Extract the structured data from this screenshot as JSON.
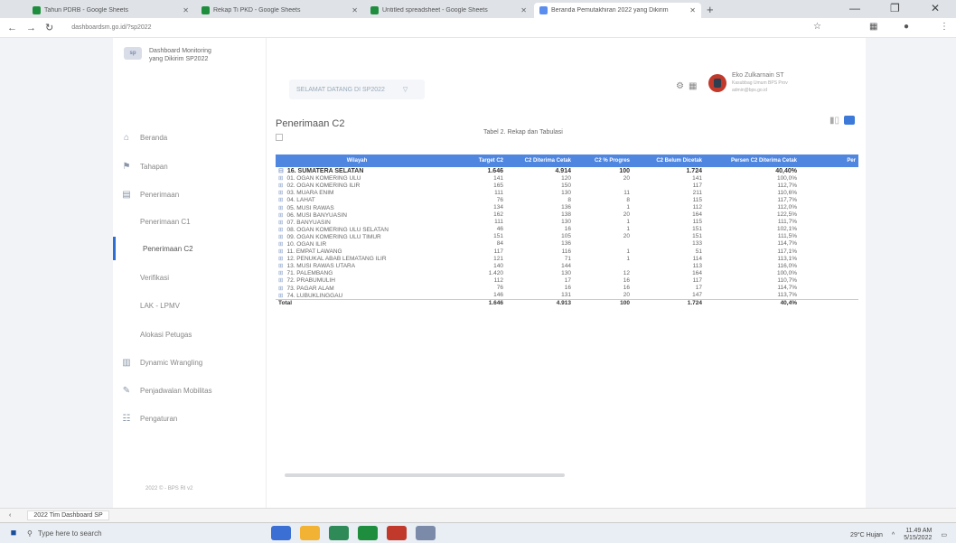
{
  "browser": {
    "tabs": [
      {
        "title": "Tahun PDRB - Google Sheets",
        "color": "#1e8e3e",
        "active": false
      },
      {
        "title": "Rekap Ti PKD - Google Sheets",
        "color": "#1e8e3e",
        "active": false
      },
      {
        "title": "Untitled spreadsheet - Google Sheets",
        "color": "#1e8e3e",
        "active": false
      },
      {
        "title": "Beranda Pemutakhiran 2022 yang Dikirim",
        "color": "#5b8def",
        "active": true
      }
    ],
    "new_tab_label": "+",
    "url": "dashboardsm.go.id/?sp2022"
  },
  "app": {
    "brand_title": "Dashboard Monitoring yang Dikirim SP2022",
    "nav": [
      {
        "label": "Beranda",
        "icon": "home-icon",
        "glyph": "⌂",
        "active": false
      },
      {
        "label": "Tahapan",
        "icon": "flag-icon",
        "glyph": "⚑",
        "active": false
      },
      {
        "label": "Penerimaan",
        "icon": "document-icon",
        "glyph": "▤",
        "active": false
      },
      {
        "label": "Penerimaan C1",
        "icon": "",
        "glyph": "",
        "active": false
      },
      {
        "label": "Penerimaan C2",
        "icon": "",
        "glyph": "",
        "active": true
      },
      {
        "label": "Verifikasi",
        "icon": "",
        "glyph": "",
        "active": false
      },
      {
        "label": "LAK - LPMV",
        "icon": "",
        "glyph": "",
        "active": false
      },
      {
        "label": "Alokasi Petugas",
        "icon": "",
        "glyph": "",
        "active": false
      },
      {
        "label": "Dynamic Wrangling",
        "icon": "chart-icon",
        "glyph": "▥",
        "active": false
      },
      {
        "label": "Penjadwalan Mobilitas",
        "icon": "pen-icon",
        "glyph": "✎",
        "active": false
      },
      {
        "label": "Pengaturan",
        "icon": "settings-icon",
        "glyph": "☷",
        "active": false
      }
    ],
    "footer": "2022 © - BPS RI v2",
    "search_placeholder": "SELAMAT DATANG DI SP2022",
    "user_name": "Eko Zulkarnain ST",
    "user_sub": "Kasubbag Umum BPS Prov",
    "user_role": "admin@bps.go.id"
  },
  "content": {
    "page_title": "Penerimaan C2",
    "table_title": "Tabel 2. Rekap dan Tabulasi",
    "columns": [
      "Wilayah",
      "Target C2",
      "C2 Diterima Cetak",
      "C2 % Progres",
      "C2 Belum Dicetak",
      "Persen C2 Diterima Cetak",
      "Per"
    ],
    "rows": [
      {
        "type": "prov",
        "name": "16. SUMATERA SELATAN",
        "v": [
          "1.646",
          "4.914",
          "100",
          "1.724",
          "40,40%",
          ""
        ]
      },
      {
        "type": "kab",
        "name": "01. OGAN KOMERING ULU",
        "v": [
          "141",
          "120",
          "20",
          "141",
          "100,0%",
          ""
        ]
      },
      {
        "type": "kab",
        "name": "02. OGAN KOMERING ILIR",
        "v": [
          "165",
          "150",
          "",
          "117",
          "112,7%",
          ""
        ]
      },
      {
        "type": "kab",
        "name": "03. MUARA ENIM",
        "v": [
          "111",
          "130",
          "11",
          "211",
          "110,6%",
          ""
        ]
      },
      {
        "type": "kab",
        "name": "04. LAHAT",
        "v": [
          "76",
          "8",
          "8",
          "115",
          "117,7%",
          ""
        ]
      },
      {
        "type": "kab",
        "name": "05. MUSI RAWAS",
        "v": [
          "134",
          "136",
          "1",
          "112",
          "112,0%",
          ""
        ]
      },
      {
        "type": "kab",
        "name": "06. MUSI BANYUASIN",
        "v": [
          "162",
          "138",
          "20",
          "164",
          "122,5%",
          ""
        ]
      },
      {
        "type": "kab",
        "name": "07. BANYUASIN",
        "v": [
          "111",
          "130",
          "1",
          "115",
          "111,7%",
          ""
        ]
      },
      {
        "type": "kab",
        "name": "08. OGAN KOMERING ULU SELATAN",
        "v": [
          "46",
          "16",
          "1",
          "151",
          "102,1%",
          ""
        ]
      },
      {
        "type": "kab",
        "name": "09. OGAN KOMERING ULU TIMUR",
        "v": [
          "151",
          "105",
          "20",
          "151",
          "111,5%",
          ""
        ]
      },
      {
        "type": "kab",
        "name": "10. OGAN ILIR",
        "v": [
          "84",
          "136",
          "",
          "133",
          "114,7%",
          ""
        ]
      },
      {
        "type": "kab",
        "name": "11. EMPAT LAWANG",
        "v": [
          "117",
          "116",
          "1",
          "51",
          "117,1%",
          ""
        ]
      },
      {
        "type": "kab",
        "name": "12. PENUKAL ABAB LEMATANG ILIR",
        "v": [
          "121",
          "71",
          "1",
          "114",
          "113,1%",
          ""
        ]
      },
      {
        "type": "kab",
        "name": "13. MUSI RAWAS UTARA",
        "v": [
          "140",
          "144",
          "",
          "113",
          "116,0%",
          ""
        ]
      },
      {
        "type": "kab",
        "name": "71. PALEMBANG",
        "v": [
          "1.420",
          "130",
          "12",
          "164",
          "100,0%",
          ""
        ]
      },
      {
        "type": "kab",
        "name": "72. PRABUMULIH",
        "v": [
          "112",
          "17",
          "16",
          "117",
          "110,7%",
          ""
        ]
      },
      {
        "type": "kab",
        "name": "73. PAGAR ALAM",
        "v": [
          "76",
          "16",
          "16",
          "17",
          "114,7%",
          ""
        ]
      },
      {
        "type": "kab",
        "name": "74. LUBUKLINGGAU",
        "v": [
          "146",
          "131",
          "20",
          "147",
          "113,7%",
          ""
        ]
      },
      {
        "type": "tot",
        "name": "Total",
        "v": [
          "1.646",
          "4.913",
          "100",
          "1.724",
          "40,4%",
          ""
        ]
      }
    ]
  },
  "downloads": {
    "file": "2022 Tim Dashboard SP"
  },
  "taskbar": {
    "search": "Type here to search",
    "weather": "29°C Hujan",
    "time": "11.49 AM",
    "date": "5/15/2022",
    "apps": [
      "#3b6fd4",
      "#f2b233",
      "#2e8b57",
      "#1e8e3e",
      "#c0392b",
      "#7a8aa8"
    ]
  }
}
